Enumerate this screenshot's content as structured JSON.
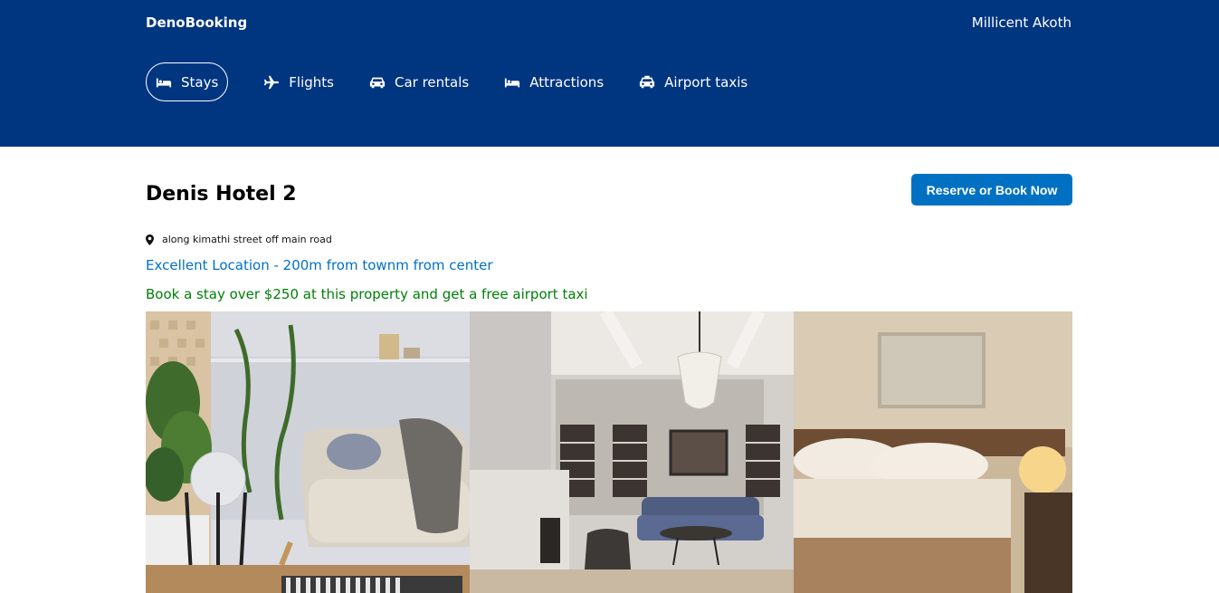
{
  "header": {
    "brand": "DenoBooking",
    "user_name": "Millicent Akoth",
    "nav": [
      {
        "label": "Stays",
        "icon": "bed-icon",
        "active": true
      },
      {
        "label": "Flights",
        "icon": "plane-icon",
        "active": false
      },
      {
        "label": "Car rentals",
        "icon": "car-icon",
        "active": false
      },
      {
        "label": "Attractions",
        "icon": "bed-icon",
        "active": false
      },
      {
        "label": "Airport taxis",
        "icon": "taxi-icon",
        "active": false
      }
    ]
  },
  "hotel": {
    "name": "Denis Hotel 2",
    "reserve_label": "Reserve or Book Now",
    "address": "along kimathi street off main road",
    "distance": "Excellent Location - 200m from townm from center",
    "offer": "Book a stay over $250 at this property and get a free airport taxi"
  },
  "colors": {
    "header_bg": "#003580",
    "accent": "#0071c2",
    "offer_green": "#008009"
  }
}
